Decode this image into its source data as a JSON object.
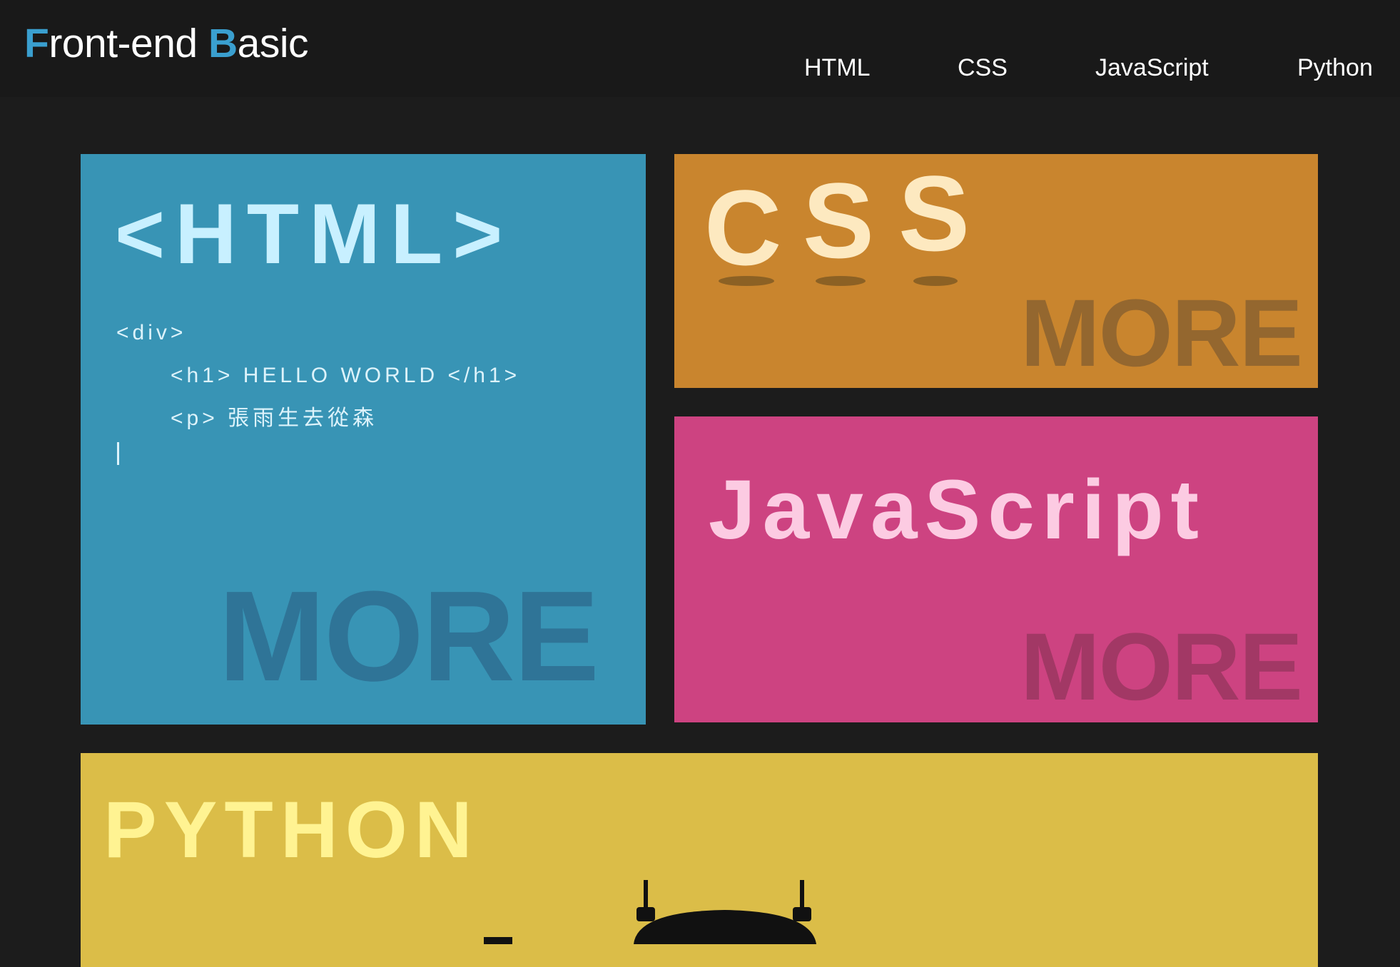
{
  "header": {
    "logo": {
      "first_initial": "F",
      "first_rest": "ront-end ",
      "second_initial": "B",
      "second_rest": "asic"
    },
    "nav": [
      {
        "label": "HTML"
      },
      {
        "label": "CSS"
      },
      {
        "label": "JavaScript"
      },
      {
        "label": "Python"
      }
    ]
  },
  "tiles": {
    "html": {
      "title": "<HTML>",
      "code_lines": [
        "<div>",
        "<h1> HELLO WORLD </h1>",
        "<p> 張雨生去從森"
      ],
      "more": "MORE"
    },
    "css": {
      "letters": [
        "C",
        "S",
        "S"
      ],
      "more": "MORE"
    },
    "javascript": {
      "title": "JavaScript",
      "more": "MORE"
    },
    "python": {
      "title": "PYTHON"
    }
  },
  "colors": {
    "page_background": "#1c1c1c",
    "header_background": "#191919",
    "accent": "#3a9fcf",
    "html_tile": "#3894b5",
    "html_title": "#c8f0ff",
    "html_more": "#2f7497",
    "css_tile": "#c9852e",
    "css_letters": "#fde9c0",
    "css_more": "#94672f",
    "js_tile": "#cd4381",
    "js_title": "#fccbe2",
    "js_more": "#a23865",
    "python_tile": "#dbbd48",
    "python_title": "#fff392"
  },
  "icons": [
    "python-robot-illustration"
  ]
}
